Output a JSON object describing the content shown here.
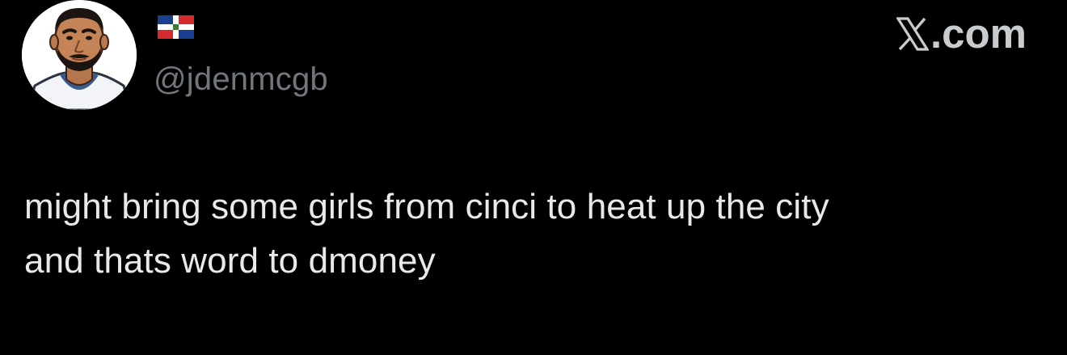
{
  "author": {
    "avatar_icon": "cartoon-player-avatar-icon",
    "flag_icon": "dominican-republic-flag-icon",
    "handle": "@jdenmcgb"
  },
  "brand": {
    "logo_icon": "x-logo-icon",
    "suffix": ".com"
  },
  "tweet": {
    "lines": [
      "might bring some girls from cinci to heat up the city",
      "and thats word to dmoney"
    ]
  },
  "colors": {
    "background": "#000000",
    "text": "#e7e9ea",
    "secondary_text": "#71767b"
  }
}
